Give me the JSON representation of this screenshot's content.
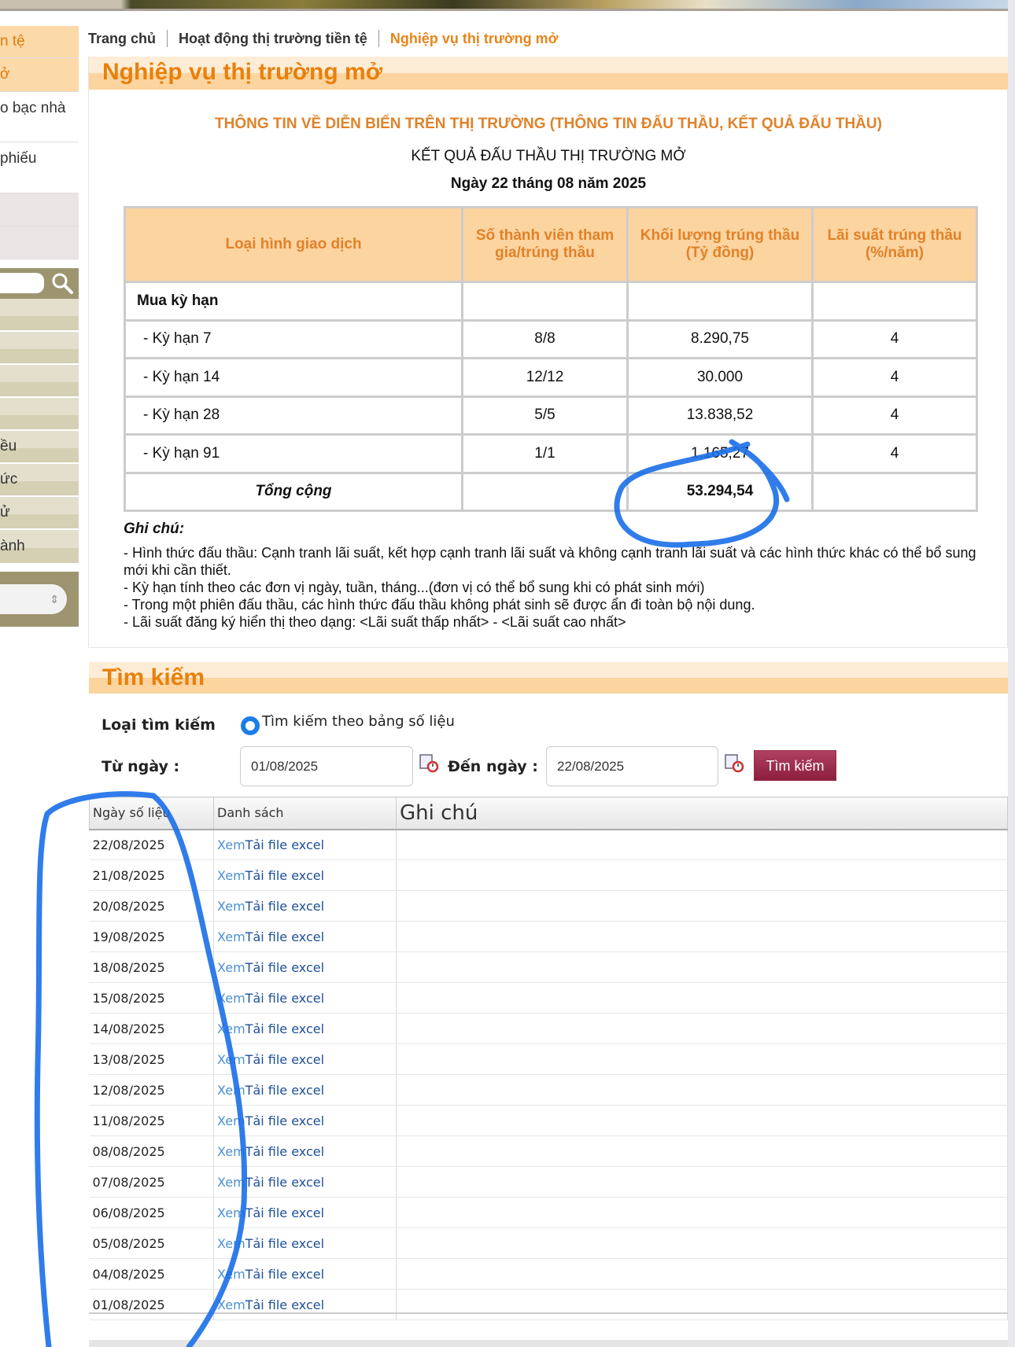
{
  "sidebar": {
    "items": [
      "n tệ",
      "ở",
      "o bạc nhà",
      "phiếu",
      "",
      "",
      "",
      "",
      "",
      "",
      "",
      "ều",
      "ức",
      "ử",
      "ành"
    ]
  },
  "breadcrumb": [
    "Trang chủ",
    "Hoạt động thị trường tiền tệ",
    "Nghiệp vụ thị trường mở"
  ],
  "section": {
    "title": "Nghiệp vụ thị trường mở",
    "heading": "THÔNG TIN VỀ DIỄN BIẾN TRÊN THỊ TRƯỜNG (THÔNG TIN ĐẤU THẦU, KẾT QUẢ ĐẤU THẦU)",
    "subheading": "KẾT QUẢ ĐẤU THẦU THỊ TRƯỜNG MỞ",
    "date": "Ngày 22 tháng 08 năm 2025"
  },
  "result_table": {
    "headers": [
      "Loại hình giao dịch",
      "Số thành viên tham gia/trúng thầu",
      "Khối lượng trúng thầu (Tỷ đồng)",
      "Lãi suất trúng thầu (%/năm)"
    ],
    "group": "Mua kỳ hạn",
    "rows": [
      [
        "- Kỳ hạn 7",
        "8/8",
        "8.290,75",
        "4"
      ],
      [
        "- Kỳ hạn 14",
        "12/12",
        "30.000",
        "4"
      ],
      [
        "- Kỳ hạn 28",
        "5/5",
        "13.838,52",
        "4"
      ],
      [
        "- Kỳ hạn 91",
        "1/1",
        "1.165,27",
        "4"
      ]
    ],
    "total_label": "Tổng cộng",
    "total": "53.294,54"
  },
  "notes": {
    "title": "Ghi chú:",
    "lines": [
      "- Hình thức đấu thầu: Cạnh tranh lãi suất, kết hợp cạnh tranh lãi suất và không cạnh tranh lãi suất và các hình thức khác có thể bổ sung mới khi cần thiết.",
      "- Kỳ hạn tính theo các đơn vị ngày, tuần, tháng...(đơn vị có thể bổ sung khi có phát sinh mới)",
      "- Trong một phiên đấu thầu, các hình thức đấu thầu không phát sinh sẽ được ẩn đi toàn bộ nội dung.",
      "- Lãi suất đăng ký hiển thị theo dạng: <Lãi suất thấp nhất> - <Lãi suất cao nhất>"
    ]
  },
  "search": {
    "title": "Tìm kiếm",
    "type_label": "Loại tìm kiếm",
    "type_option": "Tìm kiếm theo bảng số liệu",
    "from_label": "Từ ngày :",
    "from_value": "01/08/2025",
    "to_label": "Đến ngày :",
    "to_value": "22/08/2025",
    "button": "Tìm kiếm"
  },
  "grid": {
    "headers": [
      "Ngày số liệu",
      "Danh sách",
      "Ghi chú"
    ],
    "view_label": "Xem",
    "download_label": "Tải file excel",
    "dates": [
      "22/08/2025",
      "21/08/2025",
      "20/08/2025",
      "19/08/2025",
      "18/08/2025",
      "15/08/2025",
      "14/08/2025",
      "13/08/2025",
      "12/08/2025",
      "11/08/2025",
      "08/08/2025",
      "07/08/2025",
      "06/08/2025",
      "05/08/2025",
      "04/08/2025",
      "01/08/2025"
    ]
  },
  "colors": {
    "accent": "#e8800a",
    "header_bg": "#fcd4a0",
    "button": "#9a2a4a",
    "ink": "#1a6ee8"
  }
}
